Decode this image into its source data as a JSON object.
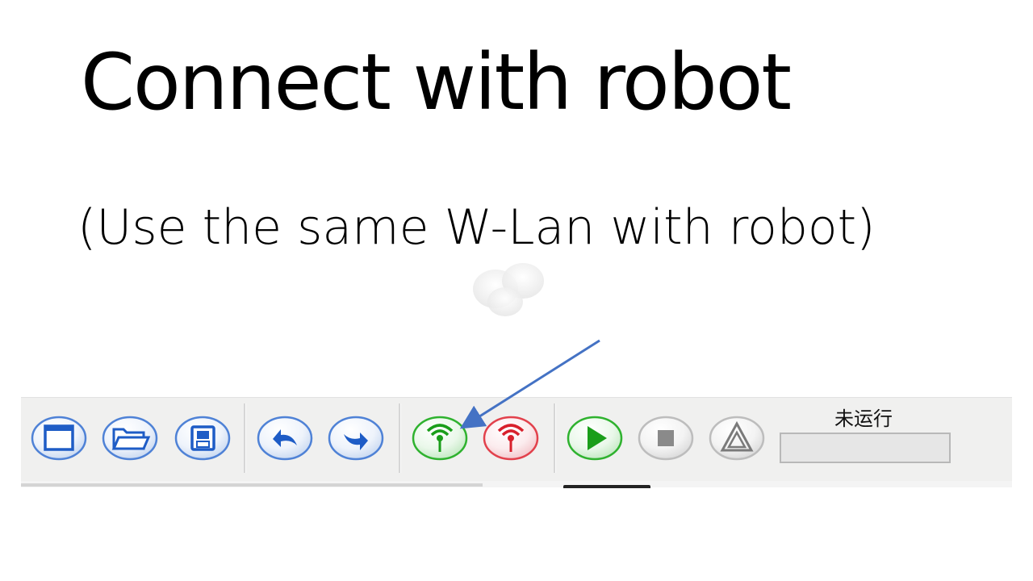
{
  "slide": {
    "title": "Connect with robot",
    "subtitle": "(Use the same W-Lan with robot)"
  },
  "toolbar": {
    "buttons": [
      {
        "name": "new-window-button",
        "icon": "window-icon",
        "color": "blue"
      },
      {
        "name": "open-folder-button",
        "icon": "folder-icon",
        "color": "blue"
      },
      {
        "name": "save-button",
        "icon": "floppy-disk-icon",
        "color": "blue"
      },
      {
        "name": "undo-button",
        "icon": "undo-arrow-icon",
        "color": "blue"
      },
      {
        "name": "redo-button",
        "icon": "redo-arrow-icon",
        "color": "blue"
      },
      {
        "name": "connect-button",
        "icon": "antenna-signal-icon",
        "color": "green"
      },
      {
        "name": "disconnect-button",
        "icon": "antenna-signal-icon",
        "color": "red"
      },
      {
        "name": "run-button",
        "icon": "play-icon",
        "color": "green"
      },
      {
        "name": "stop-button",
        "icon": "stop-square-icon",
        "color": "gray"
      },
      {
        "name": "warning-button",
        "icon": "warning-triangle-icon",
        "color": "gray"
      }
    ],
    "status": {
      "label": "未运行",
      "value": ""
    }
  },
  "colors": {
    "blue_icon": "#1e5cc6",
    "green_icon": "#1a9e1a",
    "red_icon": "#d8202c",
    "gray_icon": "#7a7a7a",
    "annotation_arrow": "#4472c4",
    "toolbar_bg": "#f0f0ef"
  }
}
